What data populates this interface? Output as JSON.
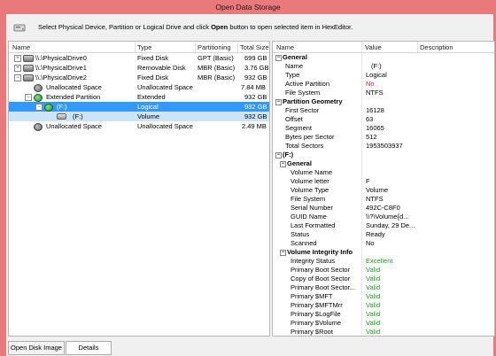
{
  "window": {
    "title": "Open Data Storage"
  },
  "instruction": {
    "prefix": "Select Physical Device, Partition or Logical Drive and click",
    "bold": "Open",
    "suffix": "button to open selected item in HexEditor."
  },
  "tree": {
    "columns": [
      "Name",
      "Type",
      "Partitioning",
      "Total Size"
    ],
    "rows": [
      {
        "name": "\\\\.\\PhysicalDrive0",
        "type": "Fixed Disk",
        "partitioning": "GPT (Basic)",
        "size": "699 GB"
      },
      {
        "name": "\\\\.\\PhysicalDrive1",
        "type": "Removable Disk",
        "partitioning": "MBR (Basic)",
        "size": "3.76 GB"
      },
      {
        "name": "\\\\.\\PhysicalDrive2",
        "type": "Fixed Disk",
        "partitioning": "MBR (Basic)",
        "size": "932 GB"
      },
      {
        "name": "Unallocated Space",
        "type": "Unallocated Space",
        "partitioning": "",
        "size": "7.84 MB"
      },
      {
        "name": "Extended Partition",
        "type": "Extended",
        "partitioning": "",
        "size": "932 GB"
      },
      {
        "name": "(F:)",
        "type": "Logical",
        "partitioning": "",
        "size": "932 GB"
      },
      {
        "name": "(F:)",
        "type": "Volume",
        "partitioning": "",
        "size": "932 GB"
      },
      {
        "name": "Unallocated Space",
        "type": "Unallocated Space",
        "partitioning": "",
        "size": "2.49 MB"
      }
    ]
  },
  "props": {
    "columns": [
      "Name",
      "Value",
      "Description"
    ],
    "general": {
      "title": "General",
      "items": [
        {
          "name": "Name",
          "value": "(F:)"
        },
        {
          "name": "Type",
          "value": "Logical"
        },
        {
          "name": "Active Partition",
          "value": "No"
        },
        {
          "name": "File System",
          "value": "NTFS"
        }
      ]
    },
    "geometry": {
      "title": "Partition Geometry",
      "items": [
        {
          "name": "First Sector",
          "value": "16128"
        },
        {
          "name": "Offset",
          "value": "63"
        },
        {
          "name": "Segment",
          "value": "16065"
        },
        {
          "name": "Bytes per Sector",
          "value": "512"
        },
        {
          "name": "Total Sectors",
          "value": "1953503937"
        }
      ]
    },
    "volume": {
      "title": "(F:)",
      "general_title": "General",
      "items": [
        {
          "name": "Volume Name",
          "value": ""
        },
        {
          "name": "Volume letter",
          "value": "F"
        },
        {
          "name": "Volume Type",
          "value": "Volume"
        },
        {
          "name": "File System",
          "value": "NTFS"
        },
        {
          "name": "Serial Number",
          "value": "492C-C8F0"
        },
        {
          "name": "GUID Name",
          "value": "\\\\?\\Volume{d..."
        },
        {
          "name": "Last Formatted",
          "value": "Sunday, 29 De..."
        },
        {
          "name": "Status",
          "value": "Ready"
        },
        {
          "name": "Scanned",
          "value": "No"
        }
      ],
      "integrity_title": "Volume Integrity Info",
      "integrity": [
        {
          "name": "Integrity Status",
          "value": "Excellent"
        },
        {
          "name": "Primary Boot Sector",
          "value": "Valid"
        },
        {
          "name": "Copy of Boot Sector",
          "value": "Valid"
        },
        {
          "name": "Primary Boot Sector...",
          "value": "Valid"
        },
        {
          "name": "Primary $MFT",
          "value": "Valid"
        },
        {
          "name": "Primary $MFTMrr",
          "value": "Valid"
        },
        {
          "name": "Primary $LogFile",
          "value": "Valid"
        },
        {
          "name": "Primary $Volume",
          "value": "Valid"
        },
        {
          "name": "Primary $Root",
          "value": "Valid"
        }
      ]
    }
  },
  "buttons": {
    "open_disk_image": "Open Disk Image",
    "details": "Details"
  },
  "colors": {
    "titlebar": "#e9797a",
    "selection": "#3399ff",
    "red_value": "#e02020",
    "green_value": "#20a020"
  }
}
